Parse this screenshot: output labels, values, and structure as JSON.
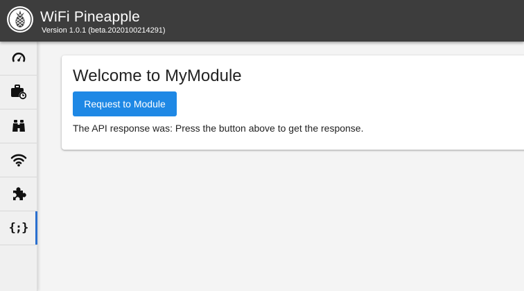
{
  "header": {
    "title": "WiFi Pineapple",
    "version": "Version 1.0.1 (beta.2020100214291)",
    "logo_icon": "pineapple-icon",
    "background": "#3d3d3d"
  },
  "sidebar": {
    "items": [
      {
        "name": "dashboard",
        "icon": "speedometer-icon",
        "active": false
      },
      {
        "name": "campaigns",
        "icon": "briefcase-clock-icon",
        "active": false
      },
      {
        "name": "recon",
        "icon": "binoculars-icon",
        "active": false
      },
      {
        "name": "pineap",
        "icon": "wifi-icon",
        "active": false
      },
      {
        "name": "modules",
        "icon": "puzzle-icon",
        "active": false
      },
      {
        "name": "mymodule",
        "icon": "code-braces-icon",
        "glyph": "{;}",
        "active": true
      }
    ],
    "active_color": "#2a6fcf"
  },
  "card": {
    "title": "Welcome to MyModule",
    "button_label": "Request to Module",
    "button_color": "#1e88e5",
    "response_prefix": "The API response was:",
    "response_text": "Press the button above to get the response."
  }
}
